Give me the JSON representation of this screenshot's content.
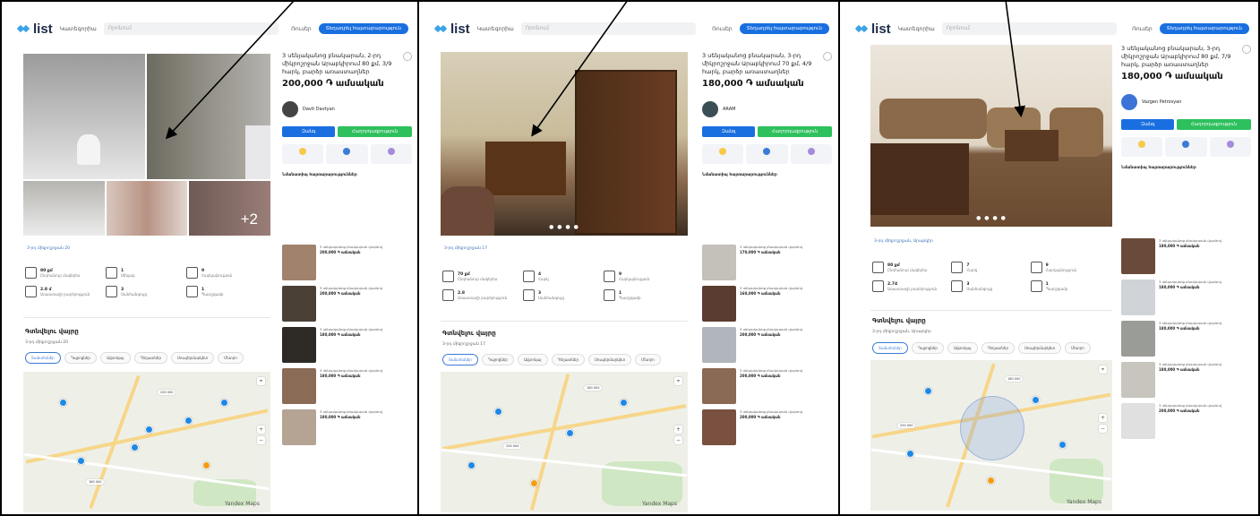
{
  "header": {
    "logo_text": "list",
    "categories_label": "Կատեգորիա",
    "search_placeholder": "Որոնում",
    "lang_label": "Ռուսեր",
    "post_button": "Տեղադրել հայտարարություն"
  },
  "listings": [
    {
      "title": "3 սենյականոց բնակարան, 2-րդ միկրոշրջան Արաբկիրում 80 քմ, 3/9 հարկ, բարձր առաստաղներ",
      "price": "200,000 ֏ ամսական",
      "owner_name": "Davit Davtyan",
      "call_label": "Զանգ",
      "message_label": "Հաղորդագրություն",
      "address": "3-րդ միկրոշրջան 20",
      "more_photos": "+2",
      "stats": [
        {
          "val": "80 քմ",
          "lbl": "Ընդհանուր մակերես"
        },
        {
          "val": "1",
          "lbl": "Սենյակ"
        },
        {
          "val": "9",
          "lbl": "Հարկայնություն"
        },
        {
          "val": "2.8 մ",
          "lbl": "Առաստաղի բարձրություն"
        },
        {
          "val": "3",
          "lbl": "Սանհանգույց"
        },
        {
          "val": "1",
          "lbl": "Պատշգամբ"
        }
      ],
      "location_title": "Գտնվելու վայրը",
      "location_sub": "3-րդ միկրոշրջան 20",
      "similar": [
        {
          "price": "200,000 ֏ ամսական"
        },
        {
          "price": "200,000 ֏ ամսական"
        },
        {
          "price": "180,000 ֏ ամսական"
        },
        {
          "price": "180,000 ֏ ամսական"
        },
        {
          "price": "180,000 ֏ ամսական"
        }
      ]
    },
    {
      "title": "3 սենյականոց բնակարան, 3-րդ միկրոշրջան Արաբկիրում 70 քմ, 4/9 հարկ, բարձր առաստաղներ",
      "price": "180,000 ֏ ամսական",
      "owner_name": "ARAM",
      "call_label": "Զանգ",
      "message_label": "Հաղորդագրություն",
      "address": "3-րդ միկրոշրջան 17",
      "stats": [
        {
          "val": "70 քմ",
          "lbl": "Ընդհանուր մակերես"
        },
        {
          "val": "4",
          "lbl": "Հարկ"
        },
        {
          "val": "9",
          "lbl": "Հարկայնություն"
        },
        {
          "val": "2.8",
          "lbl": "Առաստաղի բարձրություն"
        },
        {
          "val": "3",
          "lbl": "Սանհանգույց"
        },
        {
          "val": "1",
          "lbl": "Պատշգամբ"
        }
      ],
      "location_title": "Գտնվելու վայրը",
      "location_sub": "3-րդ միկրոշրջան 17",
      "similar": [
        {
          "price": "170,000 ֏ ամսական"
        },
        {
          "price": "160,000 ֏ ամսական"
        },
        {
          "price": "200,000 ֏ ամսական"
        },
        {
          "price": "200,000 ֏ ամսական"
        },
        {
          "price": "200,000 ֏ ամսական"
        }
      ]
    },
    {
      "title": "3 սենյականոց բնակարան, 3-րդ միկրոշրջան Արաբկիրում 80 քմ, 7/9 հարկ, բարձր առաստաղներ",
      "price": "180,000 ֏ ամսական",
      "owner_name": "Vazgen Petrosyan",
      "call_label": "Զանգ",
      "message_label": "Հաղորդագրություն",
      "address": "3-րդ միկրոշրջան, Արաբկիր",
      "stats": [
        {
          "val": "80 քմ",
          "lbl": "Ընդհանուր մակերես"
        },
        {
          "val": "7",
          "lbl": "Հարկ"
        },
        {
          "val": "9",
          "lbl": "Հարկայնություն"
        },
        {
          "val": "2.74",
          "lbl": "Առաստաղի բարձրություն"
        },
        {
          "val": "3",
          "lbl": "Սանհանգույց"
        },
        {
          "val": "1",
          "lbl": "Պատշգամբ"
        }
      ],
      "location_title": "Գտնվելու վայրը",
      "location_sub": "3-րդ միկրոշրջան, Արաբկիր",
      "similar": [
        {
          "price": "180,000 ֏ ամսական"
        },
        {
          "price": "180,000 ֏ ամսական"
        },
        {
          "price": "180,000 ֏ ամսական"
        },
        {
          "price": "180,000 ֏ ամսական"
        },
        {
          "price": "200,000 ֏ ամսական"
        }
      ]
    }
  ],
  "map_tabs": [
    "Տանտեսներ",
    "Դպրոցներ",
    "Ավտոկայ",
    "Դեղատներ",
    "Սուպերմարկետ",
    "Մետրո"
  ],
  "map_attribution": "Yandex Maps",
  "dots_indicator": "● ● ● ●"
}
